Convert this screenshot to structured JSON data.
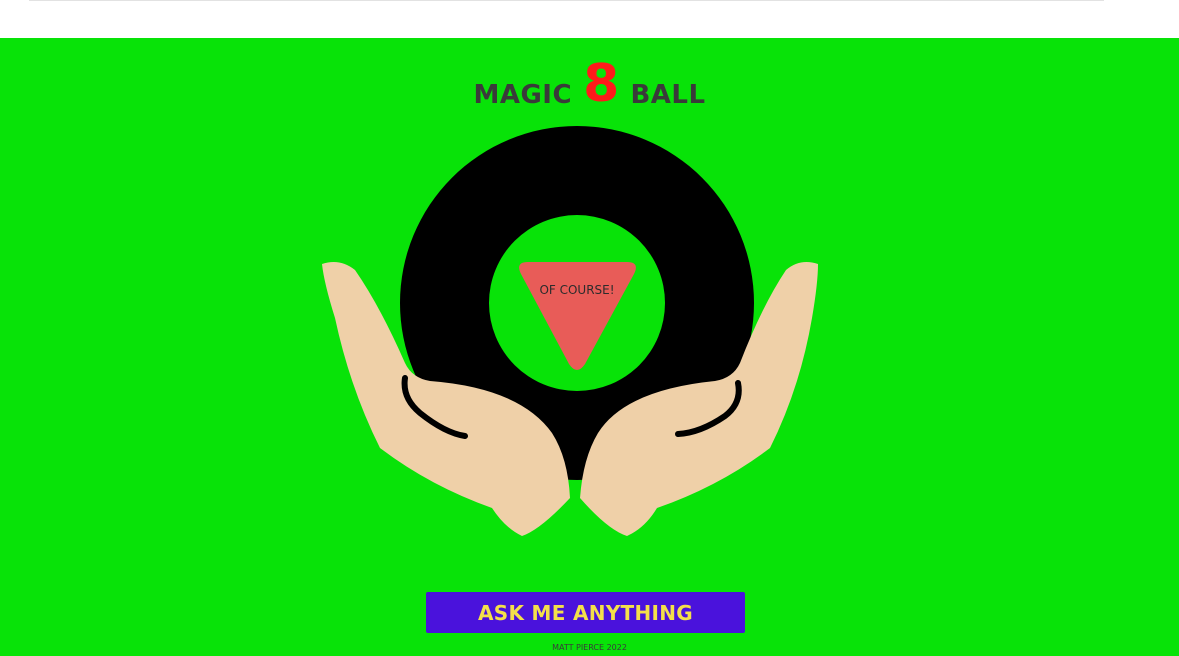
{
  "header": {
    "title_left": "MAGIC",
    "title_number": "8",
    "title_right": "BALL"
  },
  "ball": {
    "answer": "OF COURSE!"
  },
  "actions": {
    "ask_label": "ASK ME ANYTHING"
  },
  "footer": {
    "credit": "MATT PIERCE 2022"
  },
  "colors": {
    "background": "#08e308",
    "title_text": "#3a3a3a",
    "title_eight": "#ff1a1a",
    "ball": "#000000",
    "answer_triangle": "#e85c58",
    "hands": "#efd0a8",
    "button_bg": "#4a12dc",
    "button_text": "#f4e04a"
  }
}
